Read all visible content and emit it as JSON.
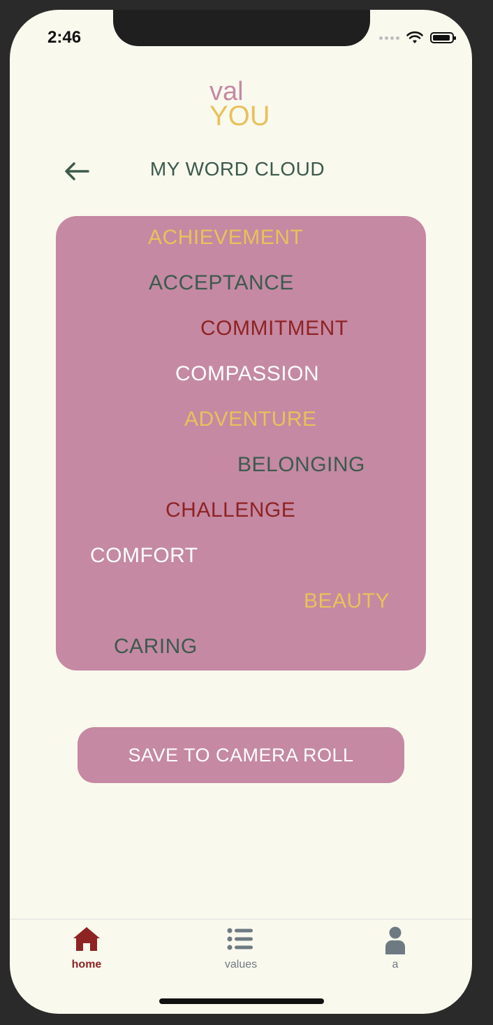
{
  "status_bar": {
    "time": "2:46"
  },
  "logo": {
    "line1": "val",
    "line2": "YOU"
  },
  "header": {
    "title": "MY WORD CLOUD"
  },
  "word_cloud": {
    "words": [
      {
        "text": "ACHIEVEMENT",
        "color": "#e8c25a"
      },
      {
        "text": "ACCEPTANCE",
        "color": "#3c5a4c"
      },
      {
        "text": "COMMITMENT",
        "color": "#8e2323"
      },
      {
        "text": "COMPASSION",
        "color": "#ffffff"
      },
      {
        "text": "ADVENTURE",
        "color": "#e8c25a"
      },
      {
        "text": "BELONGING",
        "color": "#3c5a4c"
      },
      {
        "text": "CHALLENGE",
        "color": "#8e2323"
      },
      {
        "text": "COMFORT",
        "color": "#ffffff"
      },
      {
        "text": "BEAUTY",
        "color": "#e8c25a"
      },
      {
        "text": "CARING",
        "color": "#3c5a4c"
      }
    ]
  },
  "actions": {
    "save_label": "SAVE TO CAMERA ROLL"
  },
  "tabbar": {
    "items": [
      {
        "label": "home",
        "icon": "home-icon",
        "active": true
      },
      {
        "label": "values",
        "icon": "list-icon",
        "active": false
      },
      {
        "label": "a",
        "icon": "person-icon",
        "active": false
      }
    ]
  },
  "colors": {
    "background": "#faf9ee",
    "pink": "#c589a3",
    "yellow": "#e8c25a",
    "green": "#3c5a4c",
    "red": "#8e2323",
    "inactive_tab": "#6e7a82"
  }
}
